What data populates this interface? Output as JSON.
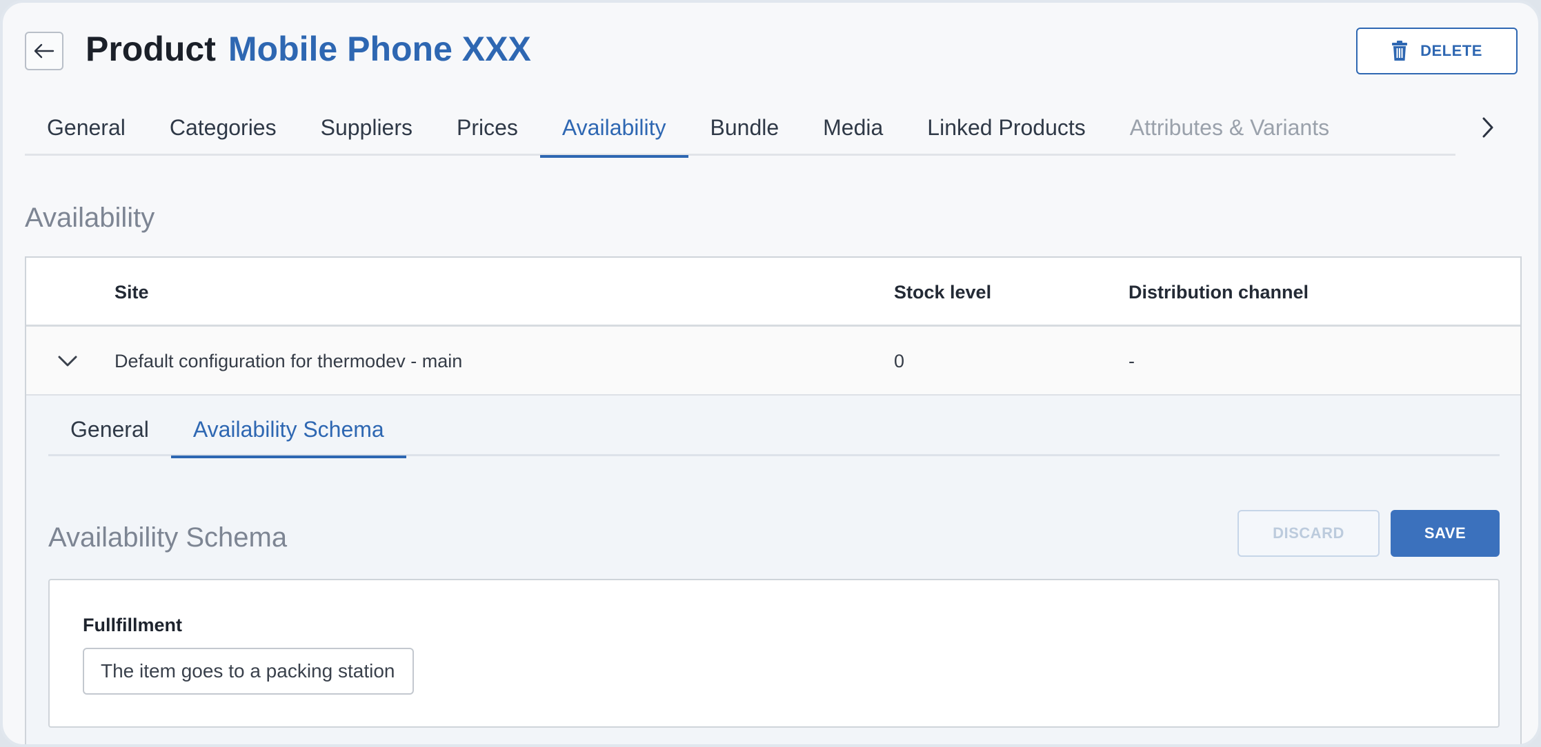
{
  "header": {
    "back_icon": "arrow-left-icon",
    "title_prefix": "Product",
    "title_name": "Mobile Phone XXX",
    "delete_label": "DELETE",
    "delete_icon": "trash-icon"
  },
  "main_tabs": [
    {
      "label": "General",
      "state": "normal"
    },
    {
      "label": "Categories",
      "state": "normal"
    },
    {
      "label": "Suppliers",
      "state": "normal"
    },
    {
      "label": "Prices",
      "state": "normal"
    },
    {
      "label": "Availability",
      "state": "active"
    },
    {
      "label": "Bundle",
      "state": "normal"
    },
    {
      "label": "Media",
      "state": "normal"
    },
    {
      "label": "Linked Products",
      "state": "normal"
    },
    {
      "label": "Attributes & Variants",
      "state": "disabled"
    }
  ],
  "tabs_next_icon": "chevron-right-icon",
  "section": {
    "title": "Availability"
  },
  "table": {
    "columns": [
      "Site",
      "Stock level",
      "Distribution channel"
    ],
    "rows": [
      {
        "site": "Default configuration for thermodev - main",
        "stock_level": "0",
        "distribution_channel": "-",
        "expanded": true,
        "toggle_icon": "chevron-down-icon"
      }
    ]
  },
  "detail": {
    "tabs": [
      {
        "label": "General",
        "state": "normal"
      },
      {
        "label": "Availability Schema",
        "state": "active"
      }
    ],
    "title": "Availability Schema",
    "discard_label": "DISCARD",
    "save_label": "SAVE",
    "form": {
      "fulfillment_label": "Fullfillment",
      "fulfillment_value": "The item goes to a packing station"
    }
  },
  "colors": {
    "accent": "#2e67b2",
    "save_button": "#3b71bd",
    "disabled_text": "#9aa1ab",
    "muted_title": "#7d8593"
  }
}
